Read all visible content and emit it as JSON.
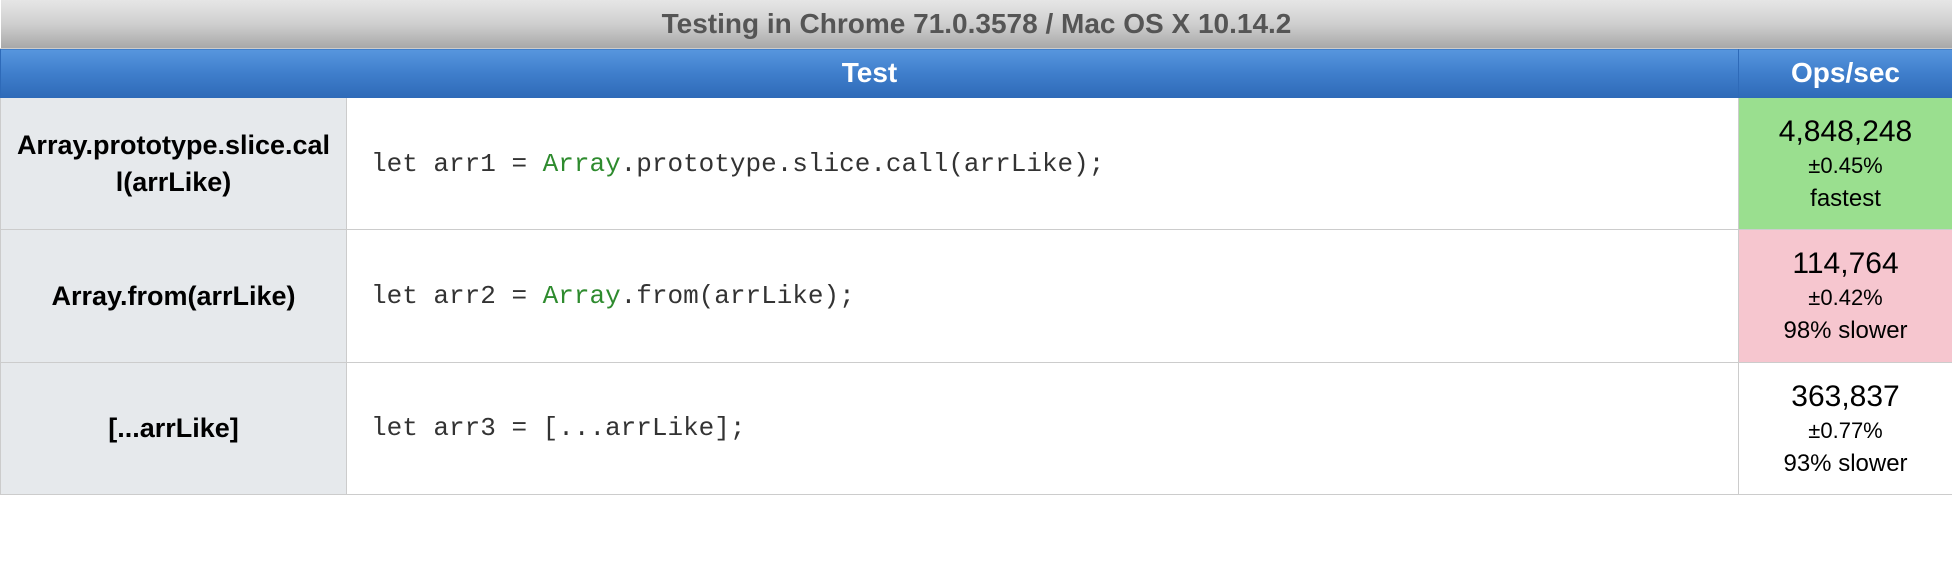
{
  "title": "Testing in Chrome 71.0.3578 / Mac OS X 10.14.2",
  "columns": {
    "test": "Test",
    "ops": "Ops/sec"
  },
  "rows": [
    {
      "name": "Array.prototype.slice.call(arrLike)",
      "code": {
        "kw": "let",
        "var": "arr1",
        "eq": " = ",
        "fn": "Array",
        "tail": ".prototype.slice.call(arrLike);"
      },
      "result": {
        "ops": "4,848,248",
        "margin": "±0.45%",
        "status": "fastest",
        "status_class": "fastest"
      }
    },
    {
      "name": "Array.from(arrLike)",
      "code": {
        "kw": "let",
        "var": "arr2",
        "eq": " = ",
        "fn": "Array",
        "tail": ".from(arrLike);"
      },
      "result": {
        "ops": "114,764",
        "margin": "±0.42%",
        "status": "98% slower",
        "status_class": "slowest"
      }
    },
    {
      "name": "[...arrLike]",
      "code": {
        "kw": "let",
        "var": "arr3",
        "eq": " = ",
        "fn": "",
        "tail": "[...arrLike];"
      },
      "result": {
        "ops": "363,837",
        "margin": "±0.77%",
        "status": "93% slower",
        "status_class": "none"
      }
    }
  ]
}
